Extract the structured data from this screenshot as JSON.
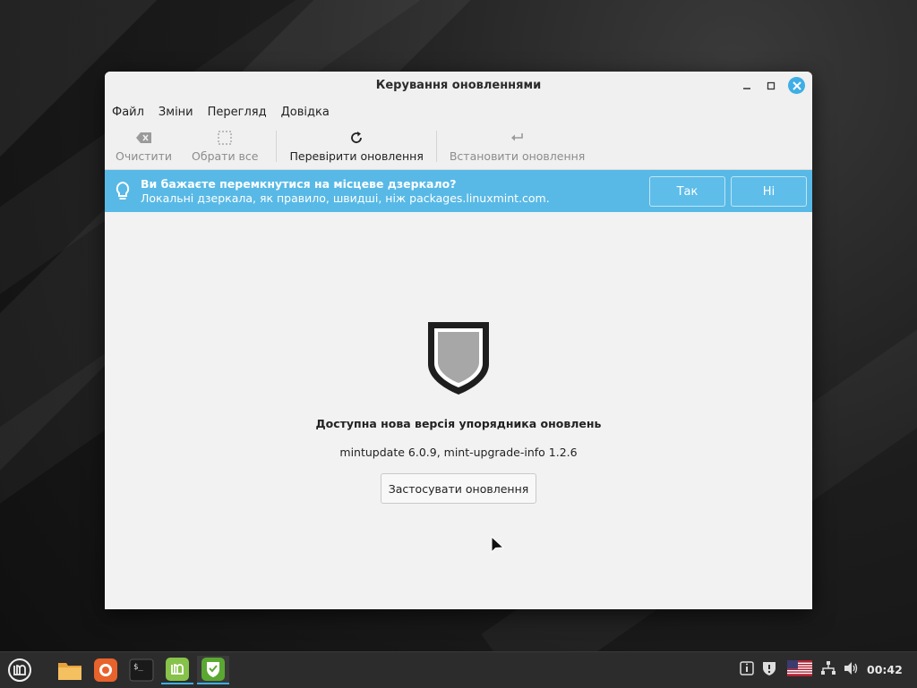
{
  "window": {
    "title": "Керування оновленнями",
    "minimize": "–",
    "maximize": "□",
    "close": "✕"
  },
  "menu": [
    "Файл",
    "Зміни",
    "Перегляд",
    "Довідка"
  ],
  "toolbar": {
    "clear": "Очистити",
    "select_all": "Обрати все",
    "refresh": "Перевірити оновлення",
    "install": "Встановити оновлення"
  },
  "infobar": {
    "title": "Ви бажаєте перемкнутися на місцеве дзеркало?",
    "subtitle": "Локальні дзеркала, як правило, швидші, ніж packages.linuxmint.com.",
    "yes": "Так",
    "no": "Ні"
  },
  "content": {
    "heading": "Доступна нова версія упорядника оновлень",
    "versions": "mintupdate 6.0.9, mint-upgrade-info 1.2.6",
    "apply": "Застосувати оновлення"
  },
  "panel": {
    "apps": [
      "menu-icon",
      "folder-icon",
      "firefox-icon",
      "terminal-icon",
      "mint-icon",
      "update-manager-icon"
    ],
    "clock": "00:42"
  },
  "colors": {
    "accent": "#3eaee6",
    "infobar": "#58b9e6"
  }
}
